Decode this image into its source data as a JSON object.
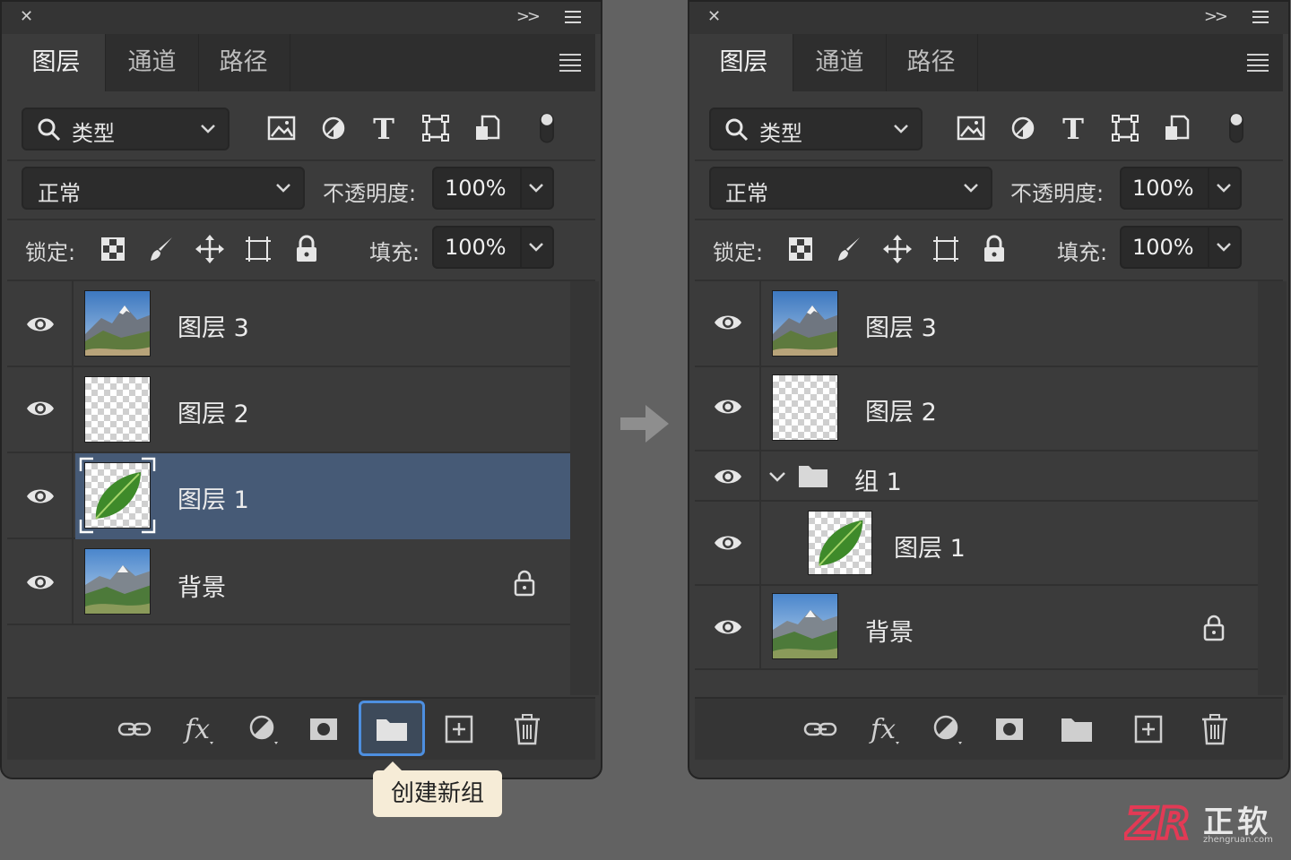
{
  "panels": [
    {
      "tabs": [
        "图层",
        "通道",
        "路径"
      ],
      "kind_filter": "类型",
      "blend_mode": "正常",
      "opacity_label": "不透明度:",
      "opacity_value": "100%",
      "lock_label": "锁定:",
      "fill_label": "填充:",
      "fill_value": "100%",
      "layers": [
        {
          "name": "图层 3",
          "type": "mountain",
          "visible": true
        },
        {
          "name": "图层 2",
          "type": "transparent",
          "visible": true
        },
        {
          "name": "图层 1",
          "type": "leaf",
          "visible": true,
          "selected": true
        },
        {
          "name": "背景",
          "type": "mountain",
          "visible": true,
          "locked": true
        }
      ]
    },
    {
      "tabs": [
        "图层",
        "通道",
        "路径"
      ],
      "kind_filter": "类型",
      "blend_mode": "正常",
      "opacity_label": "不透明度:",
      "opacity_value": "100%",
      "lock_label": "锁定:",
      "fill_label": "填充:",
      "fill_value": "100%",
      "layers": [
        {
          "name": "图层 3",
          "type": "mountain",
          "visible": true
        },
        {
          "name": "图层 2",
          "type": "transparent",
          "visible": true
        },
        {
          "name": "组 1",
          "type": "group",
          "visible": true,
          "expanded": true
        },
        {
          "name": "图层 1",
          "type": "leaf",
          "visible": true,
          "in_group": true
        },
        {
          "name": "背景",
          "type": "mountain",
          "visible": true,
          "locked": true
        }
      ]
    }
  ],
  "footer_icons": [
    "link-icon",
    "fx-icon",
    "adjustment-icon",
    "mask-icon",
    "folder-icon",
    "new-layer-icon",
    "trash-icon"
  ],
  "tooltip": "创建新组",
  "brand": {
    "logo_text": "ZR",
    "name": "正软",
    "url": "zhengruan.com"
  },
  "colors": {
    "selected_row": "#465a76",
    "highlight_border": "#4d8fe0",
    "tooltip_bg": "#f6ecd7",
    "brand_red": "#e23a55"
  }
}
